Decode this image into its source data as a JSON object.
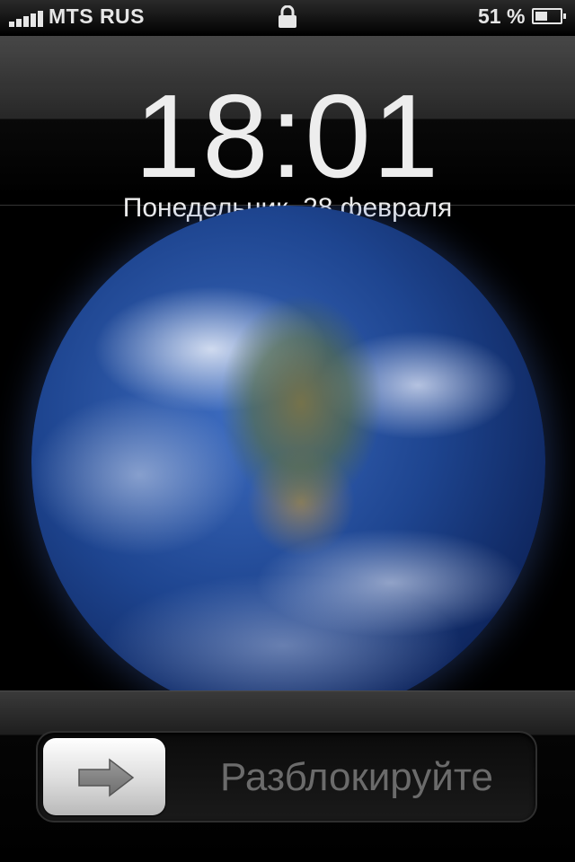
{
  "status_bar": {
    "carrier": "MTS RUS",
    "signal_bars": 5,
    "lock_icon": "lock-icon",
    "battery_percent": "51 %",
    "battery_level": 0.51
  },
  "lock_screen": {
    "time": "18:01",
    "date": "Понедельник, 28 февраля"
  },
  "wallpaper": {
    "subject": "earth-globe"
  },
  "unlock_slider": {
    "label": "Разблокируйте",
    "thumb_icon": "right-arrow-icon"
  }
}
